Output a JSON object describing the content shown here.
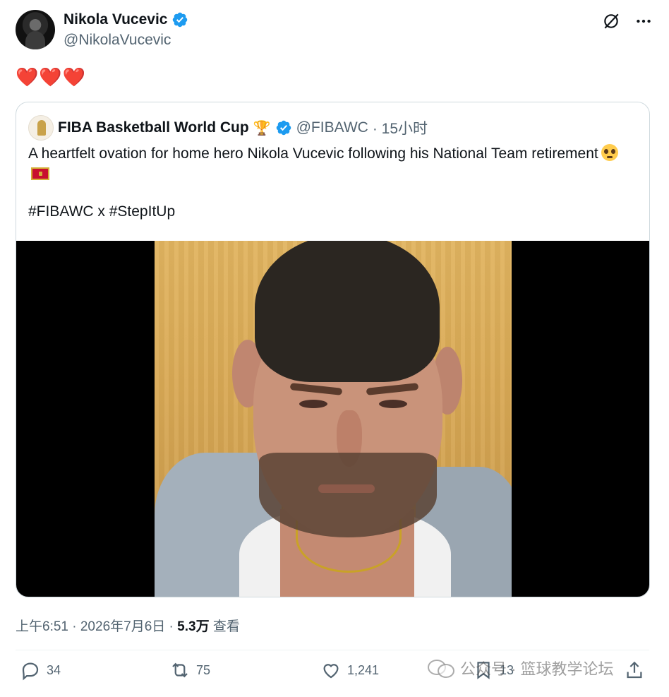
{
  "author": {
    "name": "Nikola Vucevic",
    "handle": "@NikolaVucevic",
    "verified_color": "#1d9bf0"
  },
  "top_actions": {
    "grok_icon": "grok-icon",
    "more_icon": "more-icon"
  },
  "post": {
    "text": "❤️❤️❤️"
  },
  "quote": {
    "name": "FIBA Basketball World Cup",
    "trophy": "🏆",
    "handle": "@FIBAWC",
    "time": "· 15小时",
    "body": "A heartfelt ovation for home hero Nikola Vucevic following his National Team retirement",
    "tags": "#FIBAWC x #StepItUp"
  },
  "meta": {
    "time_date": "上午6:51 · 2026年7月6日 · ",
    "views_count": "5.3万",
    "views_label": " 查看"
  },
  "actions": {
    "replies": "34",
    "reposts": "75",
    "likes": "1,241",
    "bookmarks": "13"
  },
  "watermark": {
    "text": "公众号 · 篮球教学论坛"
  }
}
